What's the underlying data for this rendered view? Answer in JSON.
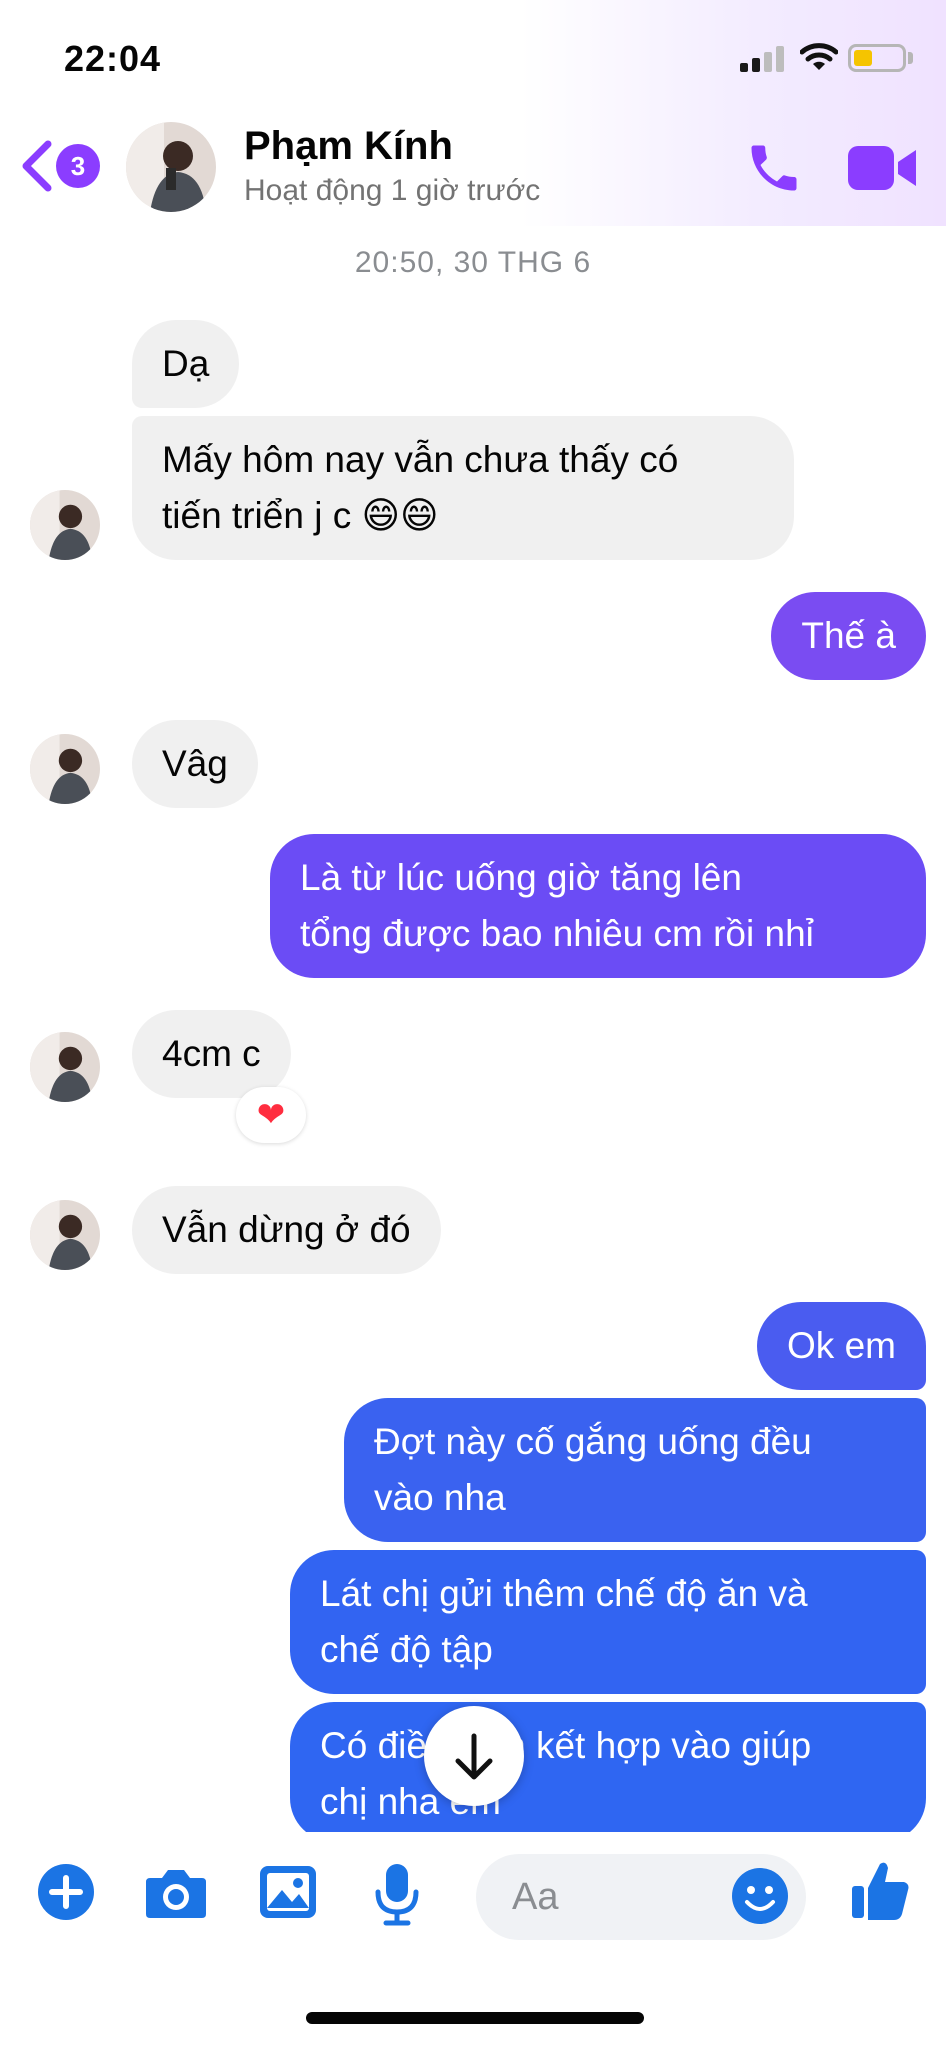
{
  "status_bar": {
    "time": "22:04"
  },
  "header": {
    "unread_count": "3",
    "contact_name": "Phạm Kính",
    "contact_status": "Hoạt động 1 giờ trước"
  },
  "conversation": {
    "timestamp": "20:50, 30 THG 6",
    "messages": [
      {
        "from": "them",
        "lines": [
          "Dạ"
        ]
      },
      {
        "from": "them",
        "lines": [
          "Mấy hôm nay vẫn chưa thấy có",
          "tiến triển j c 😄😄"
        ]
      },
      {
        "from": "me",
        "lines": [
          "Thế à"
        ]
      },
      {
        "from": "them",
        "lines": [
          "Vâg"
        ]
      },
      {
        "from": "me",
        "lines": [
          "Là từ lúc uống giờ tăng lên",
          "tổng được bao nhiêu cm rồi nhỉ"
        ]
      },
      {
        "from": "them",
        "lines": [
          "4cm c"
        ],
        "reaction": "❤"
      },
      {
        "from": "them",
        "lines": [
          "Vẫn dừng ở đó"
        ]
      },
      {
        "from": "me",
        "lines": [
          "Ok em"
        ]
      },
      {
        "from": "me",
        "lines": [
          "Đợt này cố gắng uống đều",
          "vào nha"
        ]
      },
      {
        "from": "me",
        "lines": [
          "Lát chị gửi thêm chế độ ăn và",
          "chế độ tập"
        ]
      },
      {
        "from": "me",
        "lines": [
          "Có điều kiện kết hợp vào giúp",
          "chị nha em"
        ]
      }
    ]
  },
  "composer": {
    "placeholder": "Aa"
  },
  "colors": {
    "accent": "#8b3dff",
    "outgoing_purple": "#6b4cf5",
    "outgoing_blue": "#2f66f2",
    "incoming": "#f0f0f0",
    "toolbar_icon": "#1b74e4"
  },
  "icons": [
    "back-chevron-icon",
    "phone-icon",
    "video-camera-icon",
    "plus-icon",
    "camera-icon",
    "image-icon",
    "microphone-icon",
    "emoji-icon",
    "thumbs-up-icon",
    "arrow-down-icon"
  ]
}
